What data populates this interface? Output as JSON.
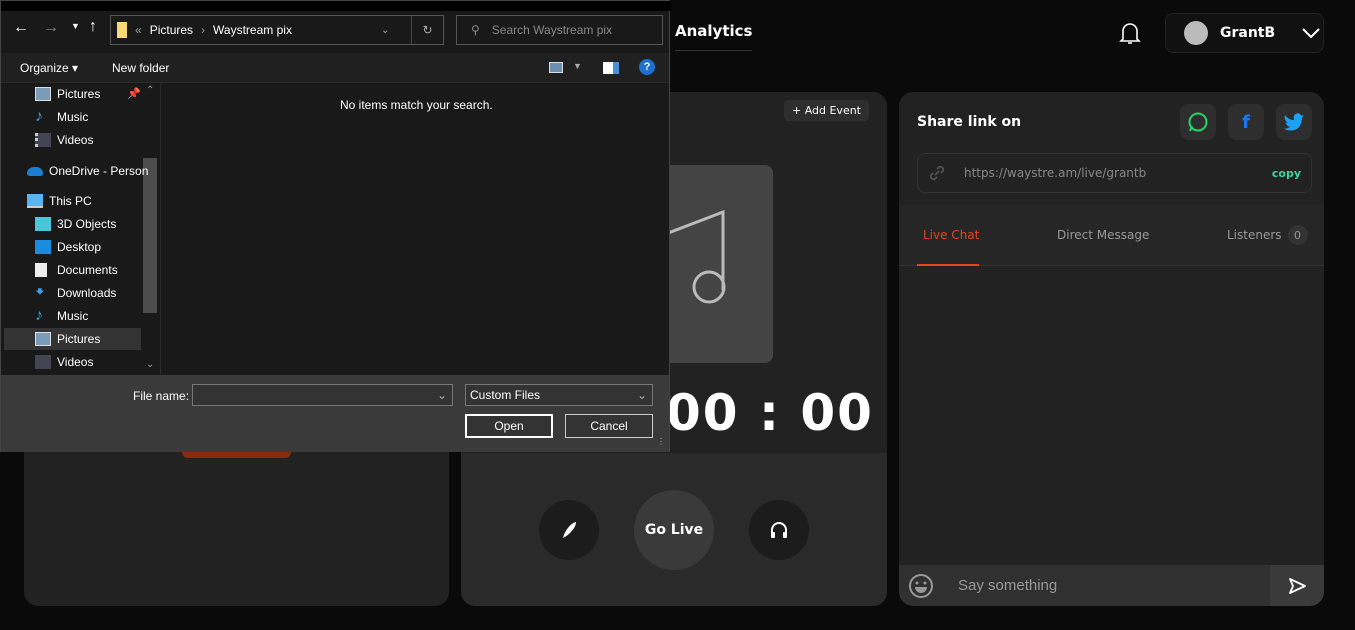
{
  "header": {
    "nav_analytics": "Analytics",
    "user_name": "GrantB"
  },
  "center": {
    "add_event": "Add Event",
    "timer": "00 : 00",
    "go_live": "Go Live"
  },
  "share": {
    "title": "Share link on",
    "url": "https://waystre.am/live/grantb",
    "copy": "copy",
    "tabs": [
      {
        "label": "Live Chat",
        "active": true
      },
      {
        "label": "Direct Message"
      },
      {
        "label": "Listeners",
        "count": "0"
      }
    ],
    "chat_placeholder": "Say something",
    "accent": "#e8431f",
    "copy_color": "#3dd6a0"
  },
  "dialog": {
    "breadcrumb": [
      "Pictures",
      "Waystream pix"
    ],
    "search_placeholder": "Search Waystream pix",
    "organize": "Organize",
    "new_folder": "New folder",
    "empty_message": "No items match your search.",
    "nav_items": [
      {
        "label": "Pictures",
        "icon": "pictures-icon"
      },
      {
        "label": "Music",
        "icon": "music-icon"
      },
      {
        "label": "Videos",
        "icon": "videos-icon"
      },
      {
        "label": "OneDrive - Person",
        "icon": "onedrive-icon"
      },
      {
        "label": "This PC",
        "icon": "pc-icon"
      },
      {
        "label": "3D Objects",
        "icon": "3d-objects-icon"
      },
      {
        "label": "Desktop",
        "icon": "desktop-icon"
      },
      {
        "label": "Documents",
        "icon": "documents-icon"
      },
      {
        "label": "Downloads",
        "icon": "downloads-icon"
      },
      {
        "label": "Music",
        "icon": "music-icon"
      },
      {
        "label": "Pictures",
        "icon": "pictures-icon",
        "selected": true
      },
      {
        "label": "Videos",
        "icon": "videos-icon"
      }
    ],
    "file_name_label": "File name:",
    "file_name_value": "",
    "file_type": "Custom Files",
    "open": "Open",
    "cancel": "Cancel"
  }
}
